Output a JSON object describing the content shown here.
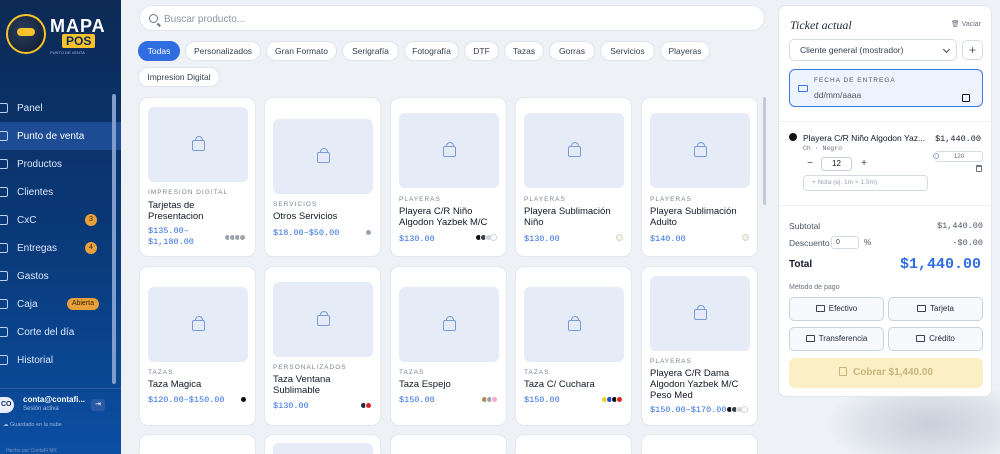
{
  "sidebar": {
    "logo": {
      "line1": "MAPA",
      "line2": "POS",
      "tagline": "PUNTO DE VENTA"
    },
    "items": [
      {
        "label": "Panel",
        "icon": "grid-icon"
      },
      {
        "label": "Punto de venta",
        "icon": "cart-icon",
        "active": true
      },
      {
        "label": "Productos",
        "icon": "box-icon"
      },
      {
        "label": "Clientes",
        "icon": "users-icon"
      },
      {
        "label": "CxC",
        "icon": "credit-icon",
        "badge": "3"
      },
      {
        "label": "Entregas",
        "icon": "truck-icon",
        "badge": "4"
      },
      {
        "label": "Gastos",
        "icon": "receipt-icon"
      },
      {
        "label": "Caja",
        "icon": "cashbox-icon",
        "badge": "Abierta"
      },
      {
        "label": "Corte del día",
        "icon": "scissors-icon"
      },
      {
        "label": "Historial",
        "icon": "history-icon"
      }
    ],
    "user": {
      "initials": "CO",
      "name": "conta@contafi...",
      "status": "Sesión activa"
    },
    "saved": "Guardado en la nube",
    "footer": "Hecho por ContaFi MX"
  },
  "search": {
    "placeholder": "Buscar producto..."
  },
  "categories": [
    "Todas",
    "Personalizados",
    "Gran Formato",
    "Serigrafía",
    "Fotografía",
    "DTF",
    "Tazas",
    "Gorras",
    "Servicios",
    "Playeras",
    "Impresion Digital"
  ],
  "products": [
    {
      "category": "IMPRESION DIGITAL",
      "name": "Tarjetas de Presentacion",
      "price": "$135.00–$1,180.00",
      "dots": [
        "#9ca3af",
        "#9ca3af",
        "#9ca3af",
        "#9ca3af"
      ]
    },
    {
      "category": "SERVICIOS",
      "name": "Otros Servicios",
      "price": "$18.00–$50.00",
      "dots": [
        "#9ca3af"
      ]
    },
    {
      "category": "PLAYERAS",
      "name": "Playera C/R Niño Algodon Yazbek M/C",
      "price": "$130.00",
      "dots": [
        "#111111",
        "#374151",
        "#d1d5db",
        "#ffffff"
      ]
    },
    {
      "category": "PLAYERAS",
      "name": "Playera Sublimación Niño",
      "price": "$130.00",
      "dots": [
        "#fdf3dc"
      ]
    },
    {
      "category": "PLAYERAS",
      "name": "Playera Sublimación Adulto",
      "price": "$140.00",
      "dots": [
        "#fdf3dc"
      ]
    },
    {
      "category": "TAZAS",
      "name": "Taza Magica",
      "price": "$120.00–$150.00",
      "dots": [
        "#111111"
      ]
    },
    {
      "category": "PERSONALIZADOS",
      "name": "Taza Ventana Sublimable",
      "price": "$130.00",
      "dots": [
        "#1f2937",
        "#dc2626"
      ]
    },
    {
      "category": "TAZAS",
      "name": "Taza Espejo",
      "price": "$150.00",
      "dots": [
        "#b08d57",
        "#9ca3af",
        "#f9a8d4"
      ]
    },
    {
      "category": "TAZAS",
      "name": "Taza C/ Cuchara",
      "price": "$150.00",
      "dots": [
        "#facc15",
        "#1d4ed8",
        "#111111",
        "#dc2626"
      ]
    },
    {
      "category": "PLAYERAS",
      "name": "Playera C/R Dama Algodon Yazbek M/C Peso Med",
      "price": "$150.00–$170.00",
      "dots": [
        "#111111",
        "#374151",
        "#d1d5db",
        "#ffffff"
      ]
    }
  ],
  "ticket": {
    "title": "Ticket actual",
    "clear": "Vaciar",
    "customer": "Cliente general (mostrador)",
    "delivery_label": "FECHA DE ENTREGA",
    "delivery_placeholder": "dd/mm/aaaa",
    "item": {
      "name": "Playera C/R Niño Algodon Yaz...",
      "price": "$1,440.00",
      "variant": "Ch · Negro",
      "unit": "120",
      "qty": "12",
      "note_placeholder": "+ Nota (ej. 1m × 1.5m)"
    },
    "subtotal_label": "Subtotal",
    "subtotal": "$1,440.00",
    "discount_label": "Descuento",
    "discount_value": "0",
    "discount_unit": "%",
    "discount_amount": "-$0.00",
    "total_label": "Total",
    "total": "$1,440.00",
    "payment_label": "Método de pago",
    "payments": [
      "Efectivo",
      "Tarjeta",
      "Transferencia",
      "Crédito"
    ],
    "charge": "Cobrar $1,440.00"
  },
  "colors": {
    "accent": "#2f6de0",
    "sidebar": "#0c2a55",
    "badge": "#e8a13a"
  }
}
